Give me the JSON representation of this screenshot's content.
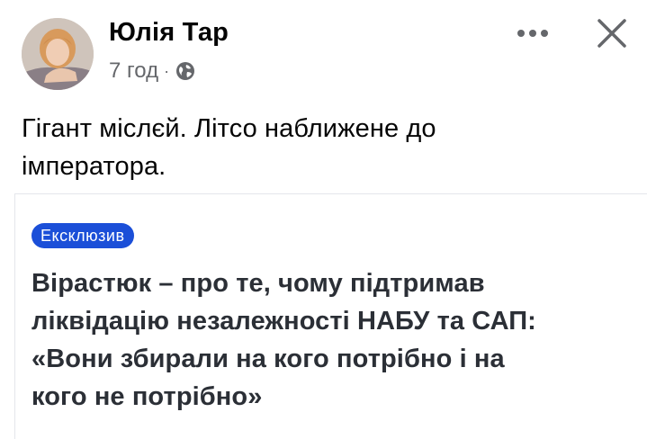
{
  "post": {
    "author_name": "Юлія Тар",
    "timestamp": "7 год",
    "separator": "·",
    "privacy_icon": "globe-icon",
    "more_icon": "more-horizontal-icon",
    "close_icon": "close-icon",
    "text_line1": "Гігант міслєй. Літсо наближене до",
    "text_line2": "імператора."
  },
  "link_card": {
    "badge": "Ексклюзив",
    "badge_color": "#1b4fd8",
    "headline_line1": "Вірастюк – про те, чому підтримав",
    "headline_line2": "ліквідацію незалежності НАБУ та САП:",
    "headline_line3": "«Вони збирали на кого потрібно і на",
    "headline_line4": "кого не потрібно»"
  }
}
